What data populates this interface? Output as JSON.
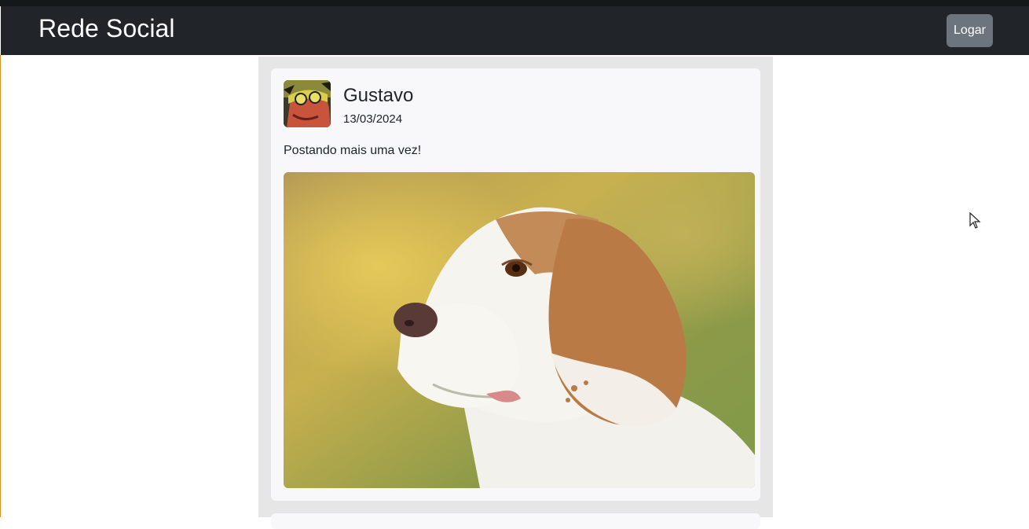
{
  "navbar": {
    "brand": "Rede Social",
    "login_label": "Logar"
  },
  "post": {
    "author": "Gustavo",
    "date": "13/03/2024",
    "content": "Postando mais uma vez!",
    "image_subject": "beagle-dog-photo"
  },
  "colors": {
    "navbar_bg": "#212529",
    "button_bg": "#6c757d",
    "feed_bg": "#e6e6e6",
    "card_bg": "#f8f8fa"
  }
}
